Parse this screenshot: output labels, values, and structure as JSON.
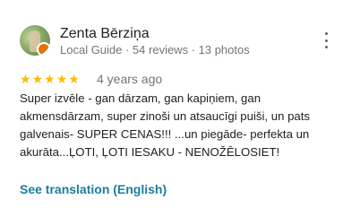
{
  "reviewer": {
    "name": "Zenta Bērziņa",
    "meta": "Local Guide · 54 reviews · 13 photos"
  },
  "rating": {
    "stars": 5,
    "max": 5
  },
  "date": "4 years ago",
  "review_text": "Super izvēle - gan dārzam, gan kapiņiem, gan akmensdārzam, super zinoši un atsaucīgi puiši, un pats galvenais- SUPER CENAS!!! ...un piegāde- perfekta un akurāta...ĻOTI, ĻOTI IESAKU - NENOŽĒLOSIET!",
  "translate_link": "See translation (English)",
  "icons": {
    "avatar": "profile-photo",
    "badge": "local-guide-badge",
    "more": "more-vert-icon",
    "star": "star-icon"
  },
  "colors": {
    "star": "#fbbc04",
    "link": "#1a7ea0",
    "secondary_text": "#70757a"
  }
}
